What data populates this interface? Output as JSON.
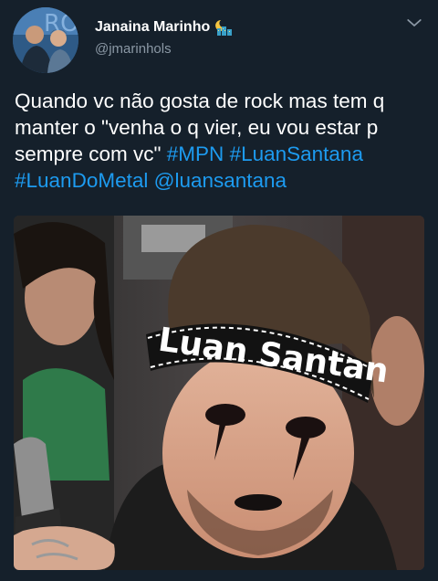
{
  "user": {
    "display_name": "Janaina Marinho",
    "handle": "@jmarinhols",
    "name_emoji_icon": "night-city-emoji-icon",
    "avatar_icon": "profile-avatar"
  },
  "header": {
    "menu_icon": "chevron-down-icon"
  },
  "tweet": {
    "text_parts": {
      "p1": "Quando vc não gosta de rock mas tem q manter o \"venha o q vier, eu vou estar p sempre com vc\" ",
      "h1": "#MPN",
      "s1": " ",
      "h2": "#LuanSantana",
      "s2": " ",
      "h3": "#LuanDoMetal",
      "s3": "  ",
      "m1": "@luansantana"
    },
    "accent_color": "#1d9bf0",
    "text_color": "#ffffff"
  },
  "media": {
    "headband_text": "Luan Santan"
  },
  "colors": {
    "background": "#15202b",
    "secondary_text": "#8b98a5"
  }
}
